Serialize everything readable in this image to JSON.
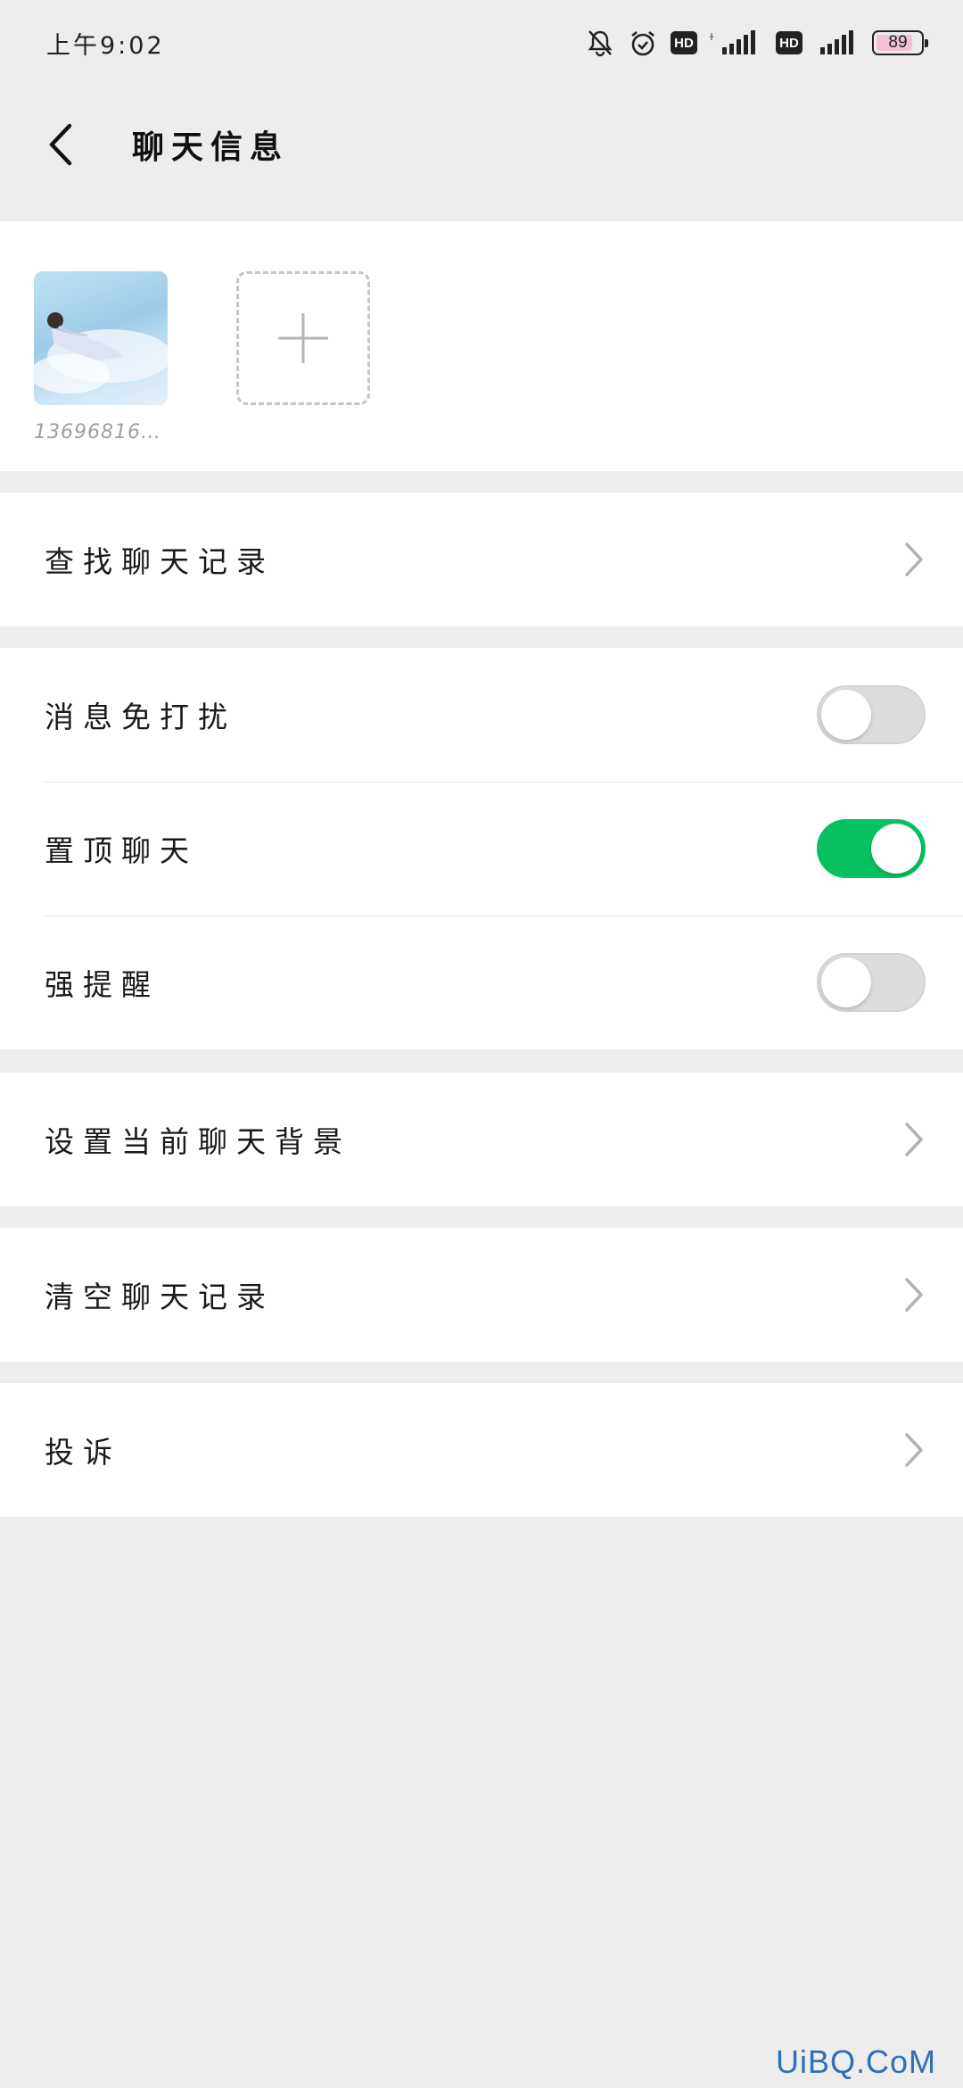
{
  "status_bar": {
    "time": "上午9:02",
    "hd_label": "HD",
    "battery_level": "89",
    "icons": [
      "mute-bell-icon",
      "alarm-icon",
      "hd-icon",
      "signal-icon",
      "hd-icon",
      "signal-icon",
      "battery-icon"
    ]
  },
  "nav": {
    "title": "聊天信息",
    "back_icon": "back-chevron-icon"
  },
  "members": [
    {
      "name": "13696816…"
    }
  ],
  "add_member_icon": "plus-icon",
  "rows": {
    "search_history": "查找聊天记录",
    "mute_notifications": "消息免打扰",
    "pin_chat": "置顶聊天",
    "strong_reminder": "强提醒",
    "set_background": "设置当前聊天背景",
    "clear_history": "清空聊天记录",
    "report": "投诉"
  },
  "toggles": {
    "mute_notifications": false,
    "pin_chat": true,
    "strong_reminder": false
  },
  "colors": {
    "accent_green": "#07c160",
    "background": "#ededed",
    "toggle_off": "#dcdcdc"
  },
  "watermark": "UiBQ.CoM"
}
